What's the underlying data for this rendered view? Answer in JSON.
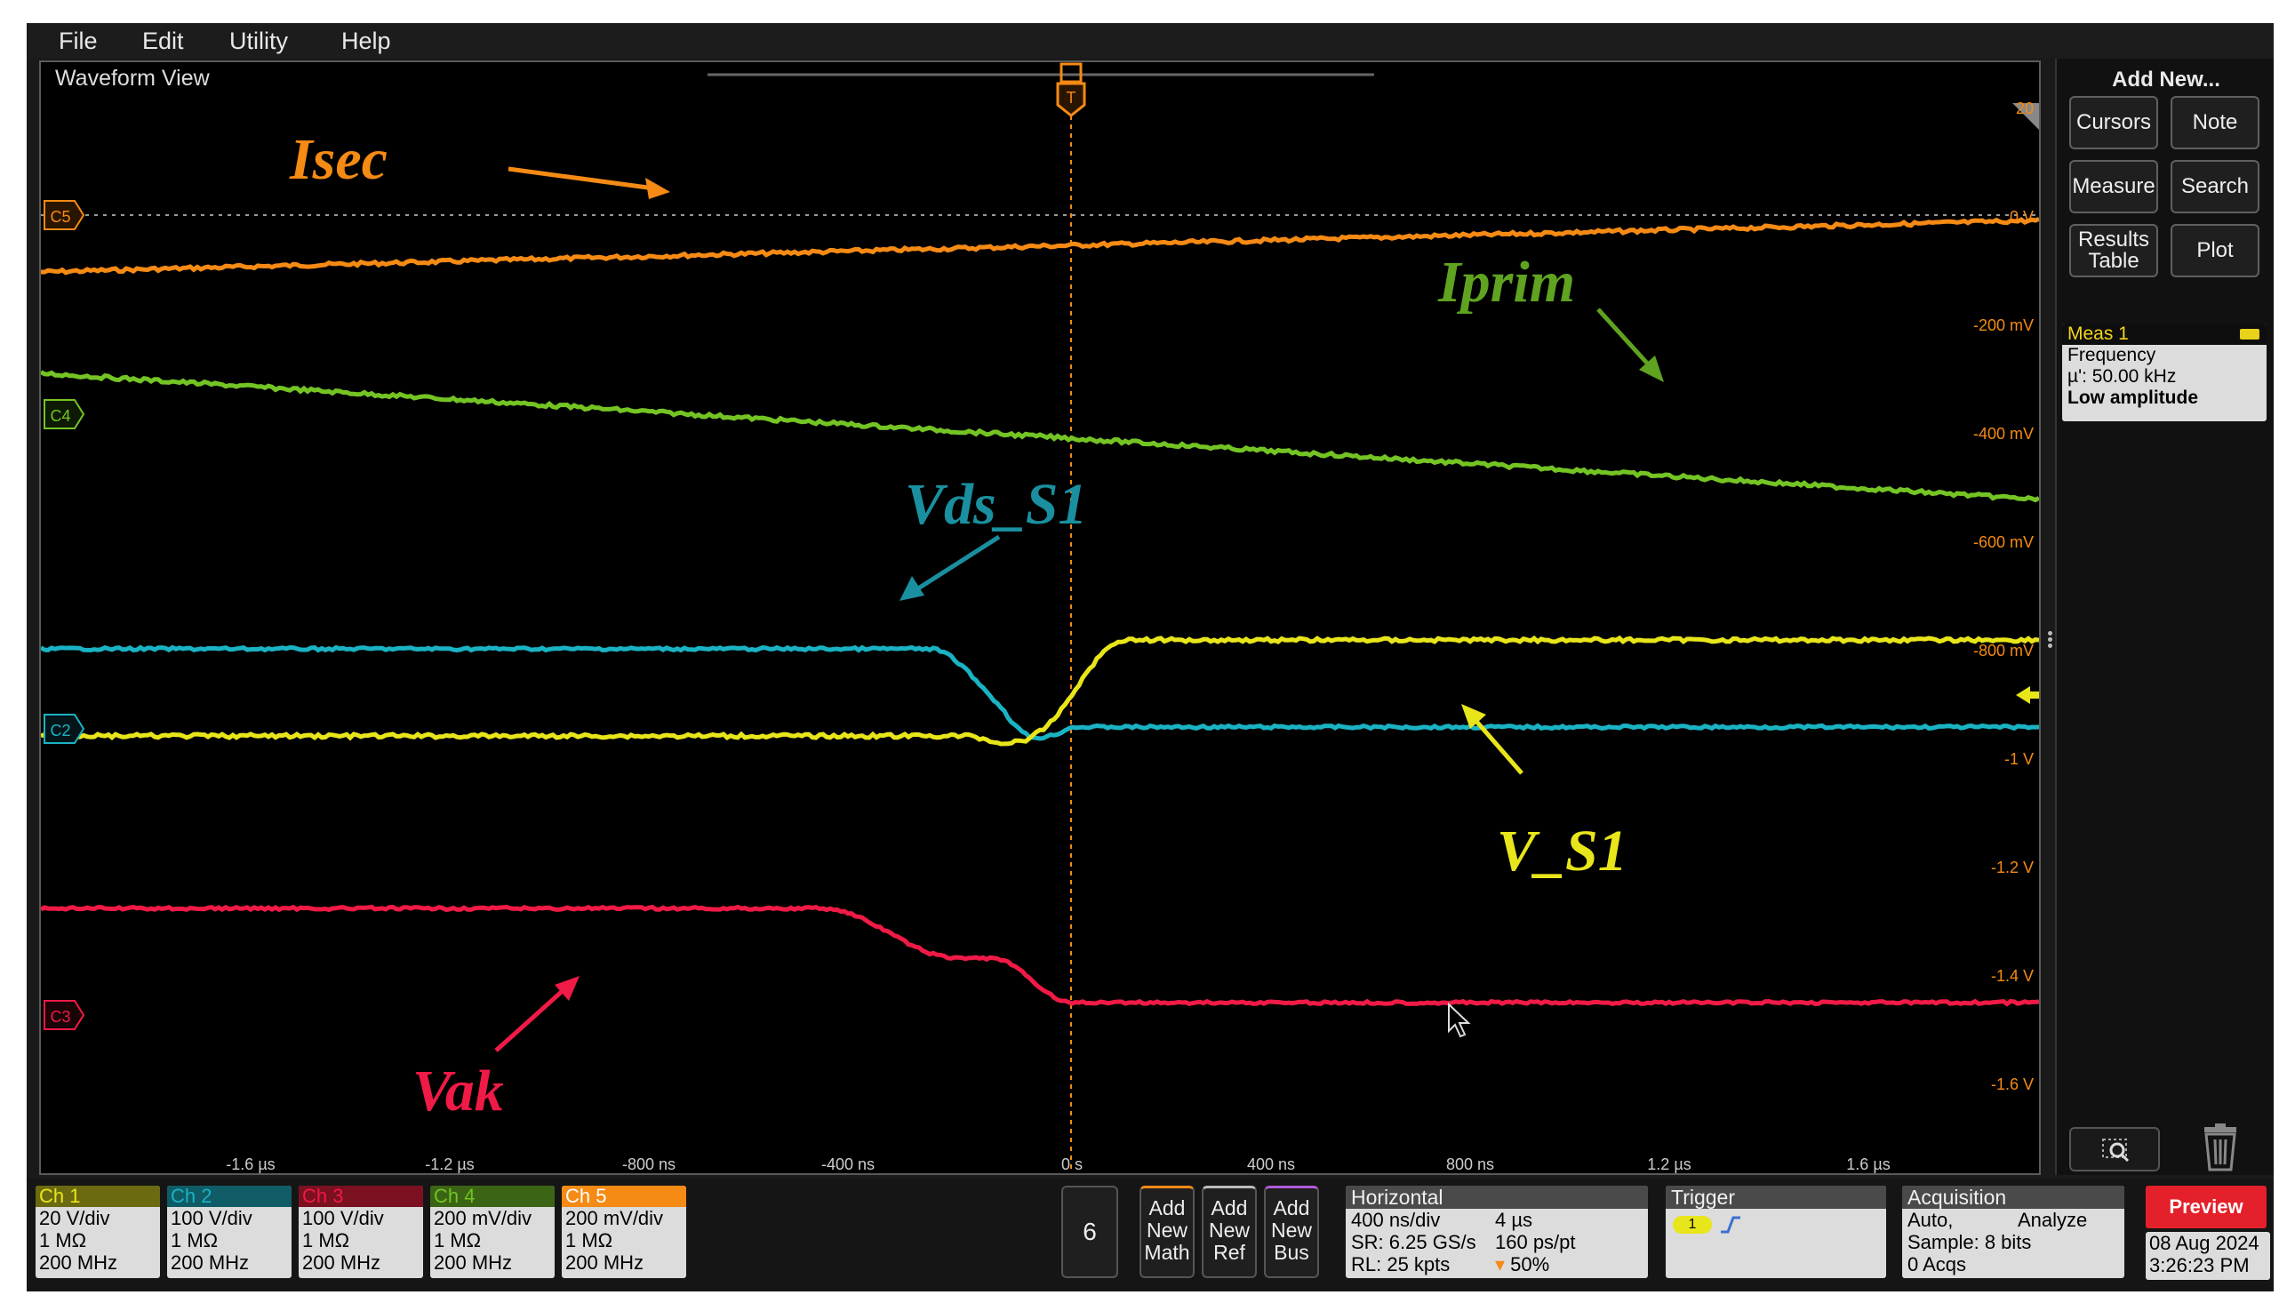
{
  "menu": [
    "File",
    "Edit",
    "Utility",
    "Help"
  ],
  "waveform_view": {
    "title": "Waveform View",
    "trigger_marker": "T",
    "y_scale_labels": [
      "20",
      "0 V",
      "-200 mV",
      "-400 mV",
      "-600 mV",
      "-800 mV",
      "-1 V",
      "-1.2 V",
      "-1.4 V",
      "-1.6 V"
    ],
    "time_labels": [
      "-1.6 µs",
      "-1.2 µs",
      "-800 ns",
      "-400 ns",
      "0 s",
      "400 ns",
      "800 ns",
      "1.2 µs",
      "1.6 µs"
    ],
    "channel_markers": [
      "C5",
      "C4",
      "C2",
      "C3"
    ],
    "annotations": {
      "isec": "Isec",
      "iprim": "Iprim",
      "vds": "Vds_S1",
      "vs1": "V_S1",
      "vak": "Vak"
    },
    "trace_colors": {
      "ch1": "#e8e61a",
      "ch2": "#1ab3c4",
      "ch3": "#f01a46",
      "ch4": "#74c424",
      "ch5": "#f58a14"
    }
  },
  "right_panel": {
    "title": "Add New...",
    "buttons": [
      "Cursors",
      "Note",
      "Measure",
      "Search",
      "Results Table",
      "Plot"
    ],
    "meas1": {
      "title": "Meas 1",
      "line1": "Frequency",
      "line2": "µ': 50.00 kHz",
      "line3": "Low amplitude"
    },
    "zoom_icon": "zoom-icon",
    "trash_icon": "trash-icon"
  },
  "bottom_bar": {
    "channels": [
      {
        "name": "Ch 1",
        "vdiv": "20 V/div",
        "imp": "1 MΩ",
        "bw": "200 MHz",
        "color": "#e8e61a"
      },
      {
        "name": "Ch 2",
        "vdiv": "100 V/div",
        "imp": "1 MΩ",
        "bw": "200 MHz",
        "color": "#1ab3c4"
      },
      {
        "name": "Ch 3",
        "vdiv": "100 V/div",
        "imp": "1 MΩ",
        "bw": "200 MHz",
        "color": "#f01a46"
      },
      {
        "name": "Ch 4",
        "vdiv": "200 mV/div",
        "imp": "1 MΩ",
        "bw": "200 MHz",
        "color": "#74c424"
      },
      {
        "name": "Ch 5",
        "vdiv": "200 mV/div",
        "imp": "1 MΩ",
        "bw": "200 MHz",
        "color": "#f58a14"
      }
    ],
    "more_channels": "6",
    "add_math": "Add New Math",
    "add_ref": "Add New Ref",
    "add_bus": "Add New Bus",
    "horizontal": {
      "title": "Horizontal",
      "l1a": "400 ns/div",
      "l1b": "4 µs",
      "l2a": "SR: 6.25 GS/s",
      "l2b": "160 ps/pt",
      "l3a": "RL: 25 kpts",
      "l3b": "50%"
    },
    "trigger": {
      "title": "Trigger",
      "source": "1"
    },
    "acquisition": {
      "title": "Acquisition",
      "l1a": "Auto,",
      "l1b": "Analyze",
      "l2": "Sample: 8 bits",
      "l3": "0 Acqs"
    },
    "preview": "Preview",
    "date": "08 Aug 2024",
    "time": "3:26:23 PM"
  }
}
